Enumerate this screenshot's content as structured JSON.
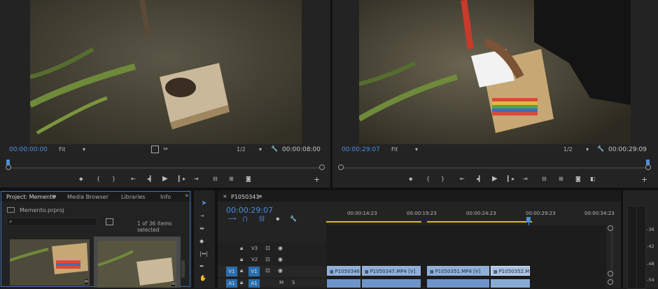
{
  "source_monitor": {
    "timecode": "00:00:00:00",
    "fit": "Fit",
    "resolution": "1/2",
    "duration": "00:00:08:00"
  },
  "program_monitor": {
    "timecode": "00:00:29:07",
    "fit": "Fit",
    "resolution": "1/2",
    "duration": "00:00:29:09"
  },
  "project_panel": {
    "tabs": [
      "Project: Memento",
      "Media Browser",
      "Libraries",
      "Info"
    ],
    "overflow": "»",
    "project_file": "Memento.prproj",
    "search_placeholder": "",
    "items_selected": "1 of 36 items selected"
  },
  "timeline": {
    "sequence_name": "P1050341",
    "close_glyph": "×",
    "timecode": "00:00:29:07",
    "ruler_ticks": [
      "00:00:14:23",
      "00:00:19:23",
      "00:00:24:23",
      "00:00:29:23",
      "00:00:34:23"
    ],
    "tracks": [
      {
        "name": "V3",
        "target": ""
      },
      {
        "name": "V2",
        "target": ""
      },
      {
        "name": "V1",
        "target": "V1"
      },
      {
        "name": "A1",
        "target": "A1"
      }
    ],
    "clips": [
      {
        "label": "P1050346"
      },
      {
        "label": "P1050347.MP4 [V]"
      },
      {
        "label": "P1050351.MP4 [V]"
      },
      {
        "label": "P1050352.M"
      }
    ],
    "audio_buttons": [
      "M",
      "S"
    ]
  },
  "audio_meter": {
    "labels": [
      "-36",
      "-42",
      "-48",
      "-54"
    ]
  },
  "icons": {
    "marker": "marker-icon",
    "in_point": "in-point-icon",
    "out_point": "out-point-icon",
    "play": "play-icon",
    "camera": "camera-icon",
    "wrench": "wrench-icon",
    "add": "add-icon",
    "selection_tool": "selection-arrow-icon"
  },
  "colors": {
    "timecode_blue": "#4a8fe0",
    "clip_blue": "#8fb0da",
    "track_target_blue": "#2a6fb0",
    "work_area_yellow": "#d8c400"
  }
}
